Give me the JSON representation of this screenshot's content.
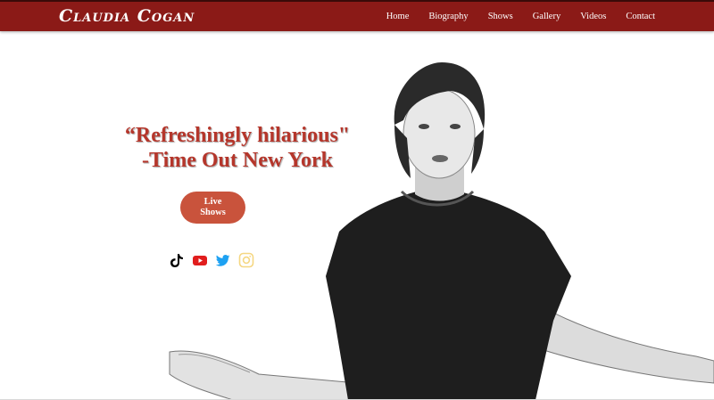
{
  "header": {
    "logo_text": "Claudia Cogan",
    "nav": [
      "Home",
      "Biography",
      "Shows",
      "Gallery",
      "Videos",
      "Contact"
    ]
  },
  "hero": {
    "quote_line1": "“Refreshingly hilarious\"",
    "quote_line2": "-Time Out New York",
    "cta_line1": "Live",
    "cta_line2": "Shows"
  },
  "socials": [
    {
      "name": "tiktok-icon",
      "color": "#000000"
    },
    {
      "name": "youtube-icon",
      "color": "#e11d1d"
    },
    {
      "name": "twitter-icon",
      "color": "#1da1f2"
    },
    {
      "name": "instagram-icon",
      "color": "#f5d782"
    }
  ],
  "colors": {
    "header_bg": "#8b1a17",
    "quote": "#b5362b",
    "cta_bg": "#c9533c"
  }
}
